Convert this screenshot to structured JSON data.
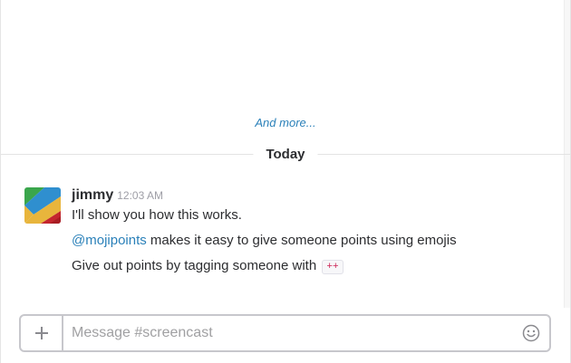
{
  "history": {
    "and_more": "And more..."
  },
  "divider": {
    "label": "Today"
  },
  "message": {
    "author": "jimmy",
    "timestamp": "12:03 AM",
    "line1": "I'll show you how this works.",
    "line2_mention": "@mojipoints",
    "line2_rest": " makes it easy to give someone points using emojis",
    "line3_text": "Give out points by tagging someone with ",
    "line3_code": "++"
  },
  "composer": {
    "placeholder": "Message #screencast",
    "value": ""
  },
  "icons": {
    "plus": "plus-icon",
    "emoji": "emoji-icon",
    "avatar": "avatar-logo"
  },
  "colors": {
    "link": "#2a80b9",
    "text": "#2c2d30",
    "muted": "#9e9ea6",
    "border": "#c7c7cc",
    "code_text": "#cc2255"
  }
}
